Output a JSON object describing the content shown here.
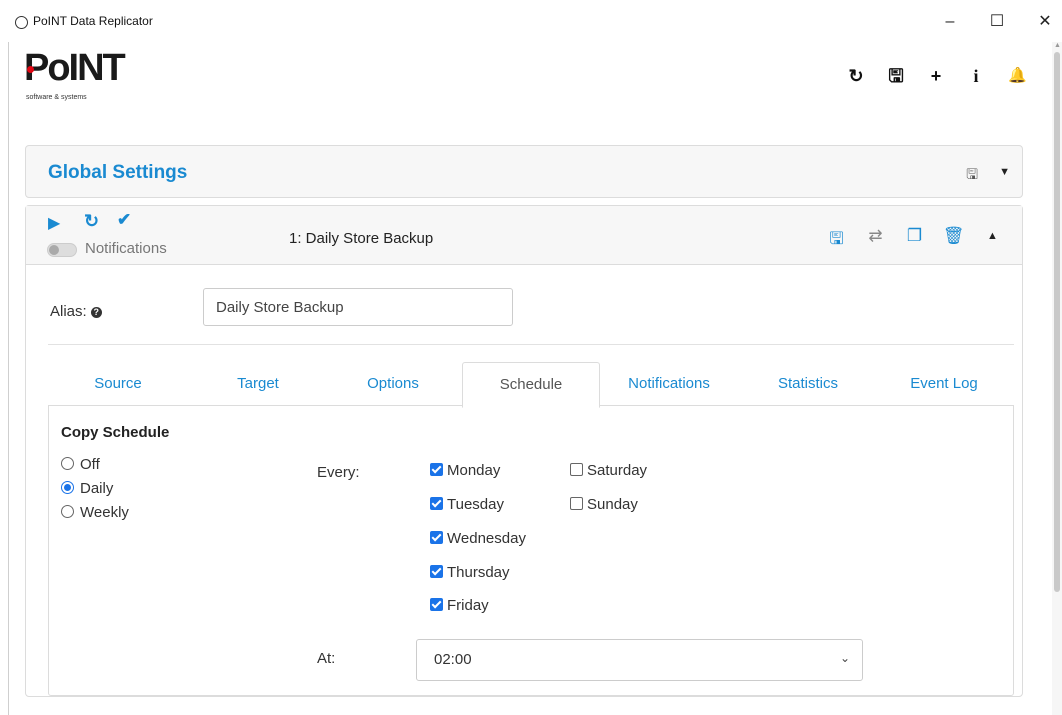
{
  "window": {
    "title": "PoINT Data Replicator",
    "minimize_glyph": "–",
    "maximize_glyph": "☐",
    "close_glyph": "✕"
  },
  "logo": {
    "mark": "PoINT",
    "tagline": "software & systems"
  },
  "toolbar": {
    "icons": [
      "refresh-icon",
      "save-icon",
      "plus-icon",
      "info-icon",
      "bell-icon"
    ],
    "glyphs": {
      "refresh": "↻",
      "save": "🖫",
      "add": "+",
      "info": "i",
      "bell": "🔔"
    }
  },
  "global_settings": {
    "title": "Global Settings",
    "save_glyph": "🖫",
    "caret": "▼"
  },
  "job": {
    "number_name": "1:  Daily Store Backup",
    "notifications_label": "Notifications",
    "notifications_enabled": false,
    "glyphs": {
      "play": "▶",
      "refresh": "↻",
      "check": "✔",
      "save": "🖫",
      "swap": "⇄",
      "copy": "❐",
      "delete": "🗑",
      "caret": "▲"
    },
    "alias_label": "Alias:",
    "alias_value": "Daily Store Backup",
    "help_glyph": "?"
  },
  "tabs": [
    {
      "label": "Source",
      "active": false
    },
    {
      "label": "Target",
      "active": false
    },
    {
      "label": "Options",
      "active": false
    },
    {
      "label": "Schedule",
      "active": true
    },
    {
      "label": "Notifications",
      "active": false
    },
    {
      "label": "Statistics",
      "active": false
    },
    {
      "label": "Event Log",
      "active": false
    }
  ],
  "schedule": {
    "title": "Copy Schedule",
    "modes": [
      {
        "label": "Off",
        "selected": false
      },
      {
        "label": "Daily",
        "selected": true
      },
      {
        "label": "Weekly",
        "selected": false
      }
    ],
    "every_label": "Every:",
    "days": [
      {
        "label": "Monday",
        "checked": true
      },
      {
        "label": "Tuesday",
        "checked": true
      },
      {
        "label": "Wednesday",
        "checked": true
      },
      {
        "label": "Thursday",
        "checked": true
      },
      {
        "label": "Friday",
        "checked": true
      },
      {
        "label": "Saturday",
        "checked": false
      },
      {
        "label": "Sunday",
        "checked": false
      }
    ],
    "at_label": "At:",
    "at_value": "02:00",
    "select_chevron": "⌄"
  },
  "colors": {
    "accent": "#1a8ad1",
    "checkbox": "#1a73e8",
    "logo_dot": "#e30613"
  }
}
